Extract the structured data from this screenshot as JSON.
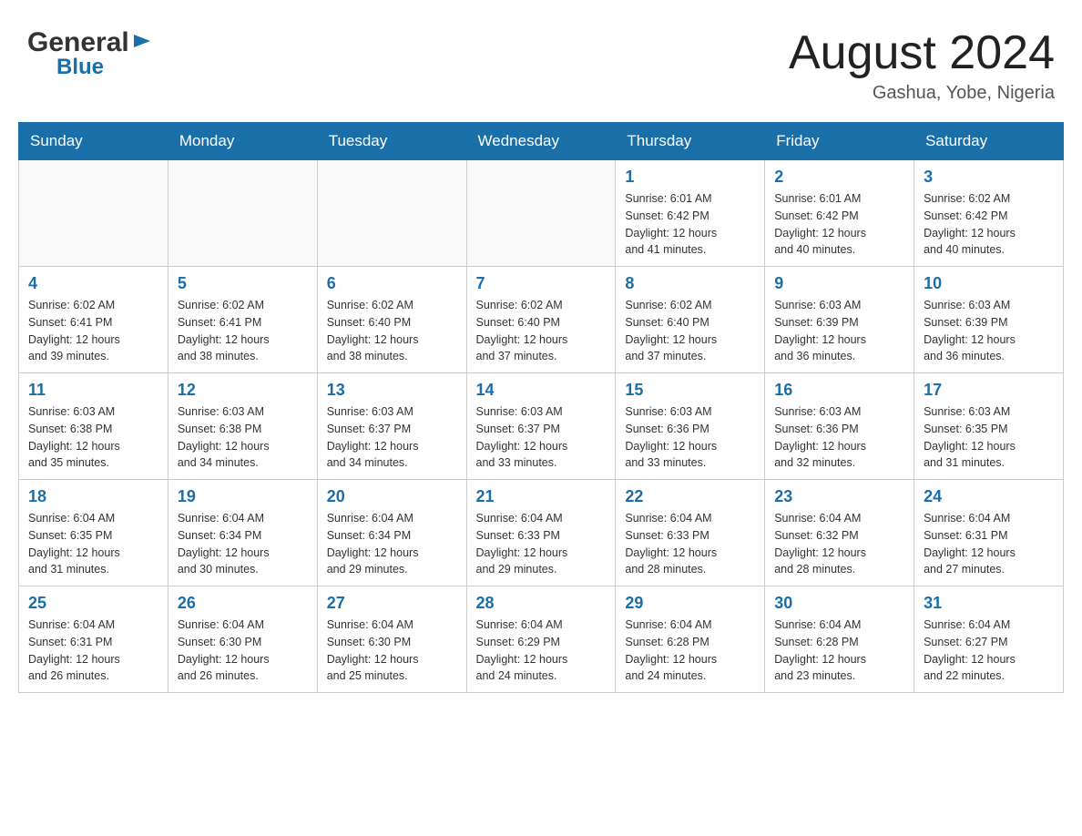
{
  "header": {
    "logo_general": "General",
    "logo_blue": "Blue",
    "month_title": "August 2024",
    "location": "Gashua, Yobe, Nigeria"
  },
  "days_of_week": [
    "Sunday",
    "Monday",
    "Tuesday",
    "Wednesday",
    "Thursday",
    "Friday",
    "Saturday"
  ],
  "weeks": [
    [
      {
        "day": "",
        "info": ""
      },
      {
        "day": "",
        "info": ""
      },
      {
        "day": "",
        "info": ""
      },
      {
        "day": "",
        "info": ""
      },
      {
        "day": "1",
        "info": "Sunrise: 6:01 AM\nSunset: 6:42 PM\nDaylight: 12 hours\nand 41 minutes."
      },
      {
        "day": "2",
        "info": "Sunrise: 6:01 AM\nSunset: 6:42 PM\nDaylight: 12 hours\nand 40 minutes."
      },
      {
        "day": "3",
        "info": "Sunrise: 6:02 AM\nSunset: 6:42 PM\nDaylight: 12 hours\nand 40 minutes."
      }
    ],
    [
      {
        "day": "4",
        "info": "Sunrise: 6:02 AM\nSunset: 6:41 PM\nDaylight: 12 hours\nand 39 minutes."
      },
      {
        "day": "5",
        "info": "Sunrise: 6:02 AM\nSunset: 6:41 PM\nDaylight: 12 hours\nand 38 minutes."
      },
      {
        "day": "6",
        "info": "Sunrise: 6:02 AM\nSunset: 6:40 PM\nDaylight: 12 hours\nand 38 minutes."
      },
      {
        "day": "7",
        "info": "Sunrise: 6:02 AM\nSunset: 6:40 PM\nDaylight: 12 hours\nand 37 minutes."
      },
      {
        "day": "8",
        "info": "Sunrise: 6:02 AM\nSunset: 6:40 PM\nDaylight: 12 hours\nand 37 minutes."
      },
      {
        "day": "9",
        "info": "Sunrise: 6:03 AM\nSunset: 6:39 PM\nDaylight: 12 hours\nand 36 minutes."
      },
      {
        "day": "10",
        "info": "Sunrise: 6:03 AM\nSunset: 6:39 PM\nDaylight: 12 hours\nand 36 minutes."
      }
    ],
    [
      {
        "day": "11",
        "info": "Sunrise: 6:03 AM\nSunset: 6:38 PM\nDaylight: 12 hours\nand 35 minutes."
      },
      {
        "day": "12",
        "info": "Sunrise: 6:03 AM\nSunset: 6:38 PM\nDaylight: 12 hours\nand 34 minutes."
      },
      {
        "day": "13",
        "info": "Sunrise: 6:03 AM\nSunset: 6:37 PM\nDaylight: 12 hours\nand 34 minutes."
      },
      {
        "day": "14",
        "info": "Sunrise: 6:03 AM\nSunset: 6:37 PM\nDaylight: 12 hours\nand 33 minutes."
      },
      {
        "day": "15",
        "info": "Sunrise: 6:03 AM\nSunset: 6:36 PM\nDaylight: 12 hours\nand 33 minutes."
      },
      {
        "day": "16",
        "info": "Sunrise: 6:03 AM\nSunset: 6:36 PM\nDaylight: 12 hours\nand 32 minutes."
      },
      {
        "day": "17",
        "info": "Sunrise: 6:03 AM\nSunset: 6:35 PM\nDaylight: 12 hours\nand 31 minutes."
      }
    ],
    [
      {
        "day": "18",
        "info": "Sunrise: 6:04 AM\nSunset: 6:35 PM\nDaylight: 12 hours\nand 31 minutes."
      },
      {
        "day": "19",
        "info": "Sunrise: 6:04 AM\nSunset: 6:34 PM\nDaylight: 12 hours\nand 30 minutes."
      },
      {
        "day": "20",
        "info": "Sunrise: 6:04 AM\nSunset: 6:34 PM\nDaylight: 12 hours\nand 29 minutes."
      },
      {
        "day": "21",
        "info": "Sunrise: 6:04 AM\nSunset: 6:33 PM\nDaylight: 12 hours\nand 29 minutes."
      },
      {
        "day": "22",
        "info": "Sunrise: 6:04 AM\nSunset: 6:33 PM\nDaylight: 12 hours\nand 28 minutes."
      },
      {
        "day": "23",
        "info": "Sunrise: 6:04 AM\nSunset: 6:32 PM\nDaylight: 12 hours\nand 28 minutes."
      },
      {
        "day": "24",
        "info": "Sunrise: 6:04 AM\nSunset: 6:31 PM\nDaylight: 12 hours\nand 27 minutes."
      }
    ],
    [
      {
        "day": "25",
        "info": "Sunrise: 6:04 AM\nSunset: 6:31 PM\nDaylight: 12 hours\nand 26 minutes."
      },
      {
        "day": "26",
        "info": "Sunrise: 6:04 AM\nSunset: 6:30 PM\nDaylight: 12 hours\nand 26 minutes."
      },
      {
        "day": "27",
        "info": "Sunrise: 6:04 AM\nSunset: 6:30 PM\nDaylight: 12 hours\nand 25 minutes."
      },
      {
        "day": "28",
        "info": "Sunrise: 6:04 AM\nSunset: 6:29 PM\nDaylight: 12 hours\nand 24 minutes."
      },
      {
        "day": "29",
        "info": "Sunrise: 6:04 AM\nSunset: 6:28 PM\nDaylight: 12 hours\nand 24 minutes."
      },
      {
        "day": "30",
        "info": "Sunrise: 6:04 AM\nSunset: 6:28 PM\nDaylight: 12 hours\nand 23 minutes."
      },
      {
        "day": "31",
        "info": "Sunrise: 6:04 AM\nSunset: 6:27 PM\nDaylight: 12 hours\nand 22 minutes."
      }
    ]
  ]
}
